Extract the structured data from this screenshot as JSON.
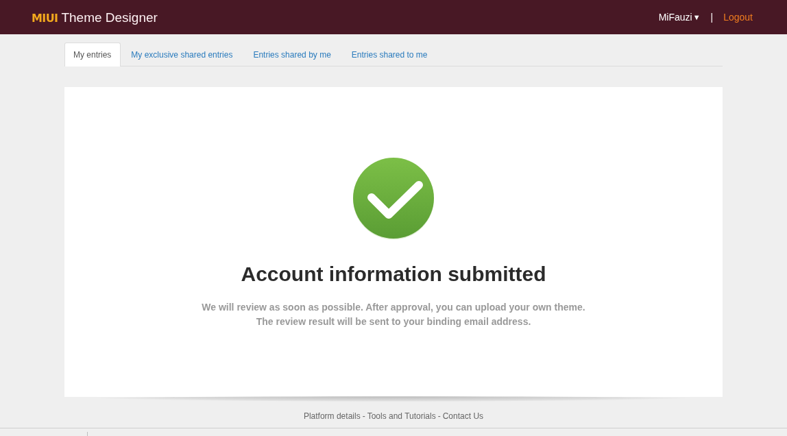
{
  "header": {
    "logo": {
      "brand": "MIUI",
      "product": "Theme Designer"
    },
    "user_menu": {
      "label": "MiFauzi",
      "caret": "▼"
    },
    "separator": "|",
    "logout": "Logout"
  },
  "tabs": [
    {
      "label": "My entries",
      "selected": true
    },
    {
      "label": "My exclusive shared entries",
      "selected": false
    },
    {
      "label": "Entries shared by me",
      "selected": false
    },
    {
      "label": "Entries shared to me",
      "selected": false
    }
  ],
  "card": {
    "title": "Account information submitted",
    "message": [
      "We will review as soon as possible. After approval, you can upload your own theme.",
      "The review result will be sent to your binding email address."
    ]
  },
  "footer": {
    "links": [
      {
        "label": "Platform details",
        "separator": "-"
      },
      {
        "label": "Tools and Tutorials",
        "separator": "-"
      },
      {
        "label": "Contact Us"
      }
    ]
  }
}
